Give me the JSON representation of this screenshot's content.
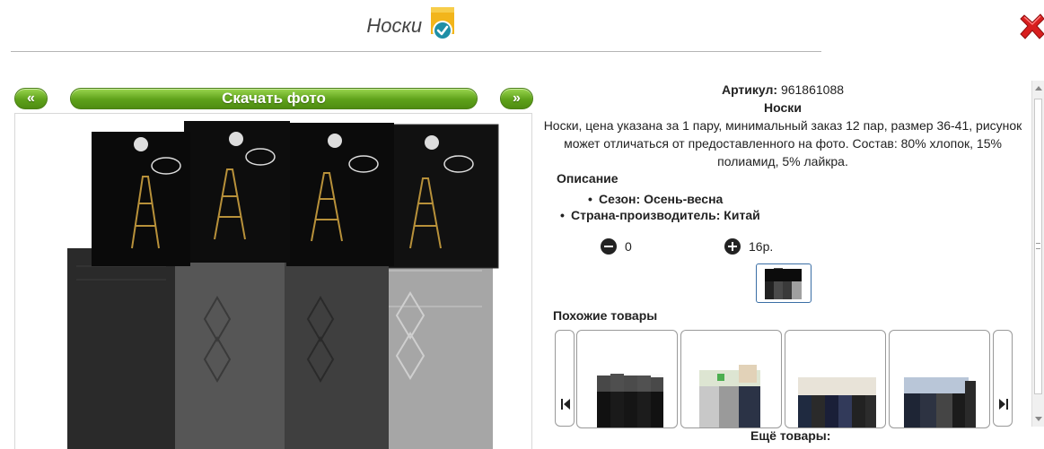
{
  "header": {
    "title": "Носки",
    "badge_icon": "verified-check-icon",
    "close_icon": "close-x-icon"
  },
  "gallery": {
    "prev_label": "«",
    "next_label": "»",
    "download_label": "Скачать фото",
    "button_color": "#5ea11a",
    "photo_icon": "socks-product-photo"
  },
  "product": {
    "sku_label": "Артикул:",
    "sku_value": "961861088",
    "name": "Носки",
    "description": "Носки, цена указана за 1 пару, минимальный заказ 12 пар, размер 36-41, рисунок может отличаться от предоставленного на фото. Состав: 80% хлопок, 15% полиамид, 5% лайкра.",
    "desc_title": "Описание",
    "properties": [
      "Сезон: Осень-весна",
      "Страна-производитель: Китай"
    ]
  },
  "order": {
    "minus_icon": "minus-circle-icon",
    "quantity": "0",
    "plus_icon": "plus-circle-icon",
    "price": "16р."
  },
  "similar": {
    "title": "Похожие товары",
    "prev_icon": "skip-back-icon",
    "next_icon": "skip-forward-icon",
    "more_label": "Ещё товары:"
  }
}
